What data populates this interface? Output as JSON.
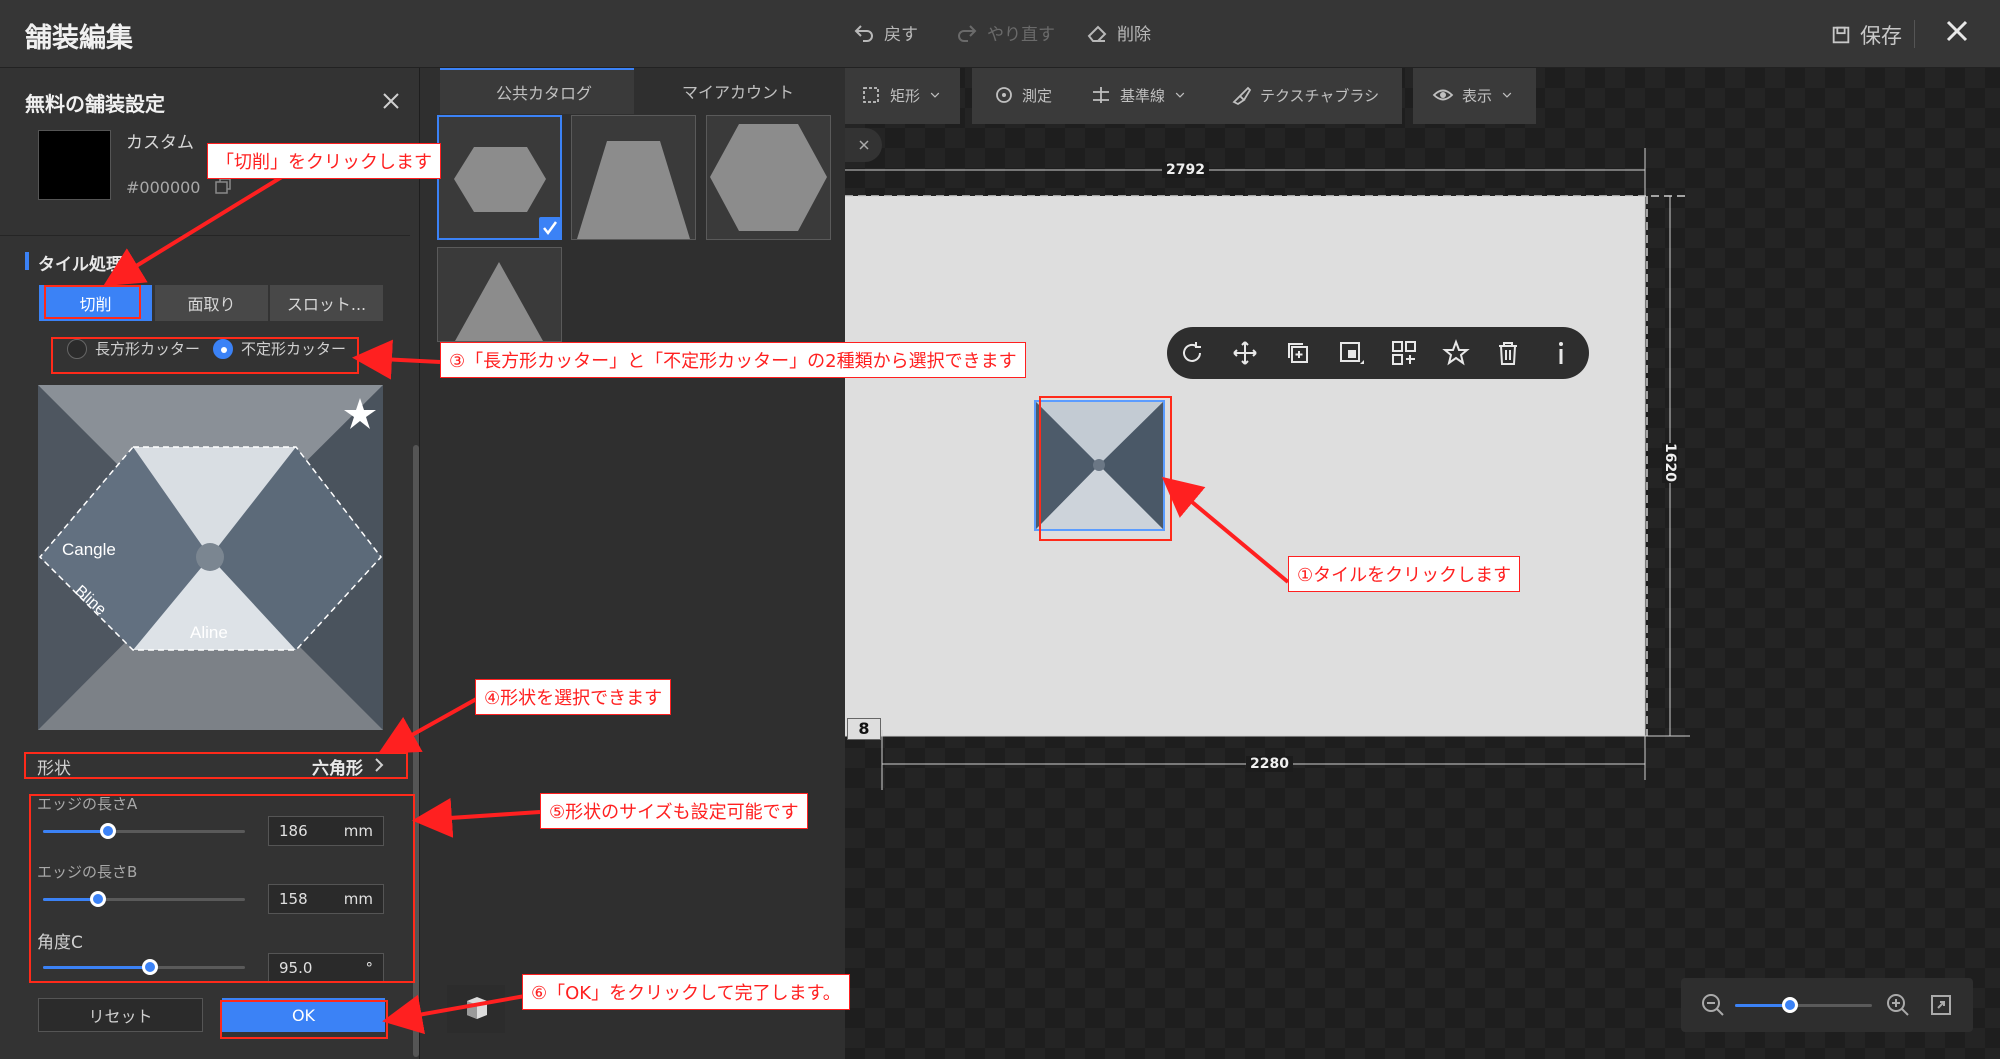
{
  "header": {
    "title": "舗装編集",
    "undo": "戻す",
    "redo": "やり直す",
    "delete": "削除",
    "save": "保存"
  },
  "panel": {
    "title": "無料の舗装設定",
    "color_name": "カスタム",
    "color_hex": "#000000",
    "section": "タイル処理",
    "tabs": [
      "切削",
      "面取り",
      "スロット..."
    ],
    "cutters": [
      "長方形カッター",
      "不定形カッター"
    ],
    "selected_cutter": "不定形カッター",
    "preview_labels": {
      "c": "Cangle",
      "b": "Bline",
      "a": "Aline"
    },
    "shape_label": "形状",
    "shape_value": "六角形",
    "params": [
      {
        "label": "エッジの長さA",
        "value": "186",
        "unit": "mm",
        "level": 0.32
      },
      {
        "label": "エッジの長さB",
        "value": "158",
        "unit": "mm",
        "level": 0.27
      },
      {
        "label": "角度C",
        "value": "95.0",
        "unit": "°",
        "level": 0.53
      }
    ],
    "reset": "リセット",
    "ok": "OK"
  },
  "catalog": {
    "tabs": [
      "公共カタログ",
      "マイアカウント"
    ]
  },
  "canvas": {
    "tools": [
      "矩形",
      "測定",
      "基準線",
      "テクスチャブラシ",
      "表示"
    ],
    "dimensions": {
      "top": "2792",
      "right": "1620",
      "bottom": "2280",
      "left": "8"
    },
    "zoom_level": 0.4
  },
  "annotations": {
    "cut": "「切削」をクリックします",
    "step1": "①タイルをクリックします",
    "step3": "③「長方形カッター」と「不定形カッター」の2種類から選択できます",
    "step4": "④形状を選択できます",
    "step5": "⑤形状のサイズも設定可能です",
    "step6": "⑥「OK」をクリックして完了します。"
  },
  "colors": {
    "accent": "#3b82f6",
    "annotation": "#ff2020"
  }
}
